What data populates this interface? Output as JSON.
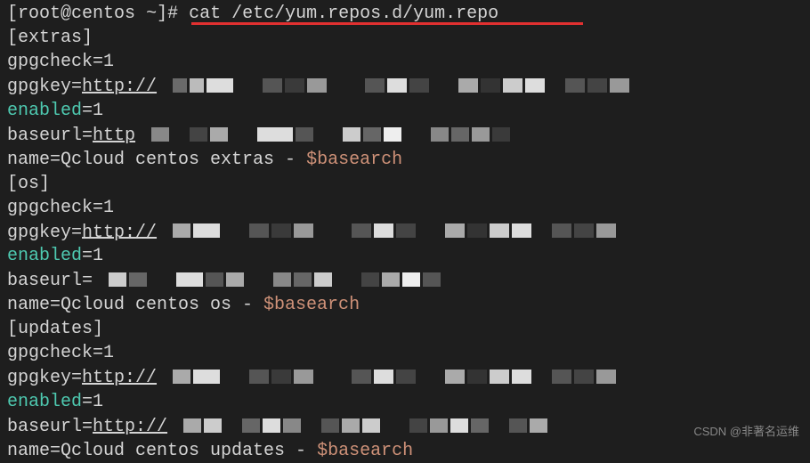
{
  "prompt": {
    "user": "root@centos",
    "dir": "~",
    "symbol": "#",
    "command": "cat /etc/yum.repos.d/yum.repo"
  },
  "sections": {
    "extras": {
      "header": "[extras]",
      "gpgcheck": "gpgcheck=1",
      "gpgkey_prefix": "gpgkey=",
      "gpgkey_url": "http://",
      "enabled_key": "enabled",
      "enabled_val": "=1",
      "baseurl_prefix": "baseurl=",
      "baseurl_url": "http",
      "name_prefix": "name=Qcloud centos extras - ",
      "name_var": "$basearch"
    },
    "os": {
      "header": "[os]",
      "gpgcheck": "gpgcheck=1",
      "gpgkey_prefix": "gpgkey=",
      "gpgkey_url": "http://",
      "enabled_key": "enabled",
      "enabled_val": "=1",
      "baseurl_prefix": "baseurl=",
      "name_prefix": "name=Qcloud centos os - ",
      "name_var": "$basearch"
    },
    "updates": {
      "header": "[updates]",
      "gpgcheck": "gpgcheck=1",
      "gpgkey_prefix": "gpgkey=",
      "gpgkey_url": "http://",
      "enabled_key": "enabled",
      "enabled_val": "=1",
      "baseurl_prefix": "baseurl=",
      "baseurl_url": "http://",
      "name_prefix": "name=Qcloud centos updates - ",
      "name_var": "$basearch"
    }
  },
  "watermark": "CSDN @非著名运维",
  "censor_colors": {
    "dark1": "#2b2b2b",
    "dark2": "#3a3a3a",
    "mid1": "#555",
    "mid2": "#6a6a6a",
    "mid3": "#7a7a7a",
    "light1": "#9a9a9a",
    "light2": "#aaa",
    "light3": "#bbb",
    "light4": "#ccc",
    "light5": "#ddd"
  }
}
